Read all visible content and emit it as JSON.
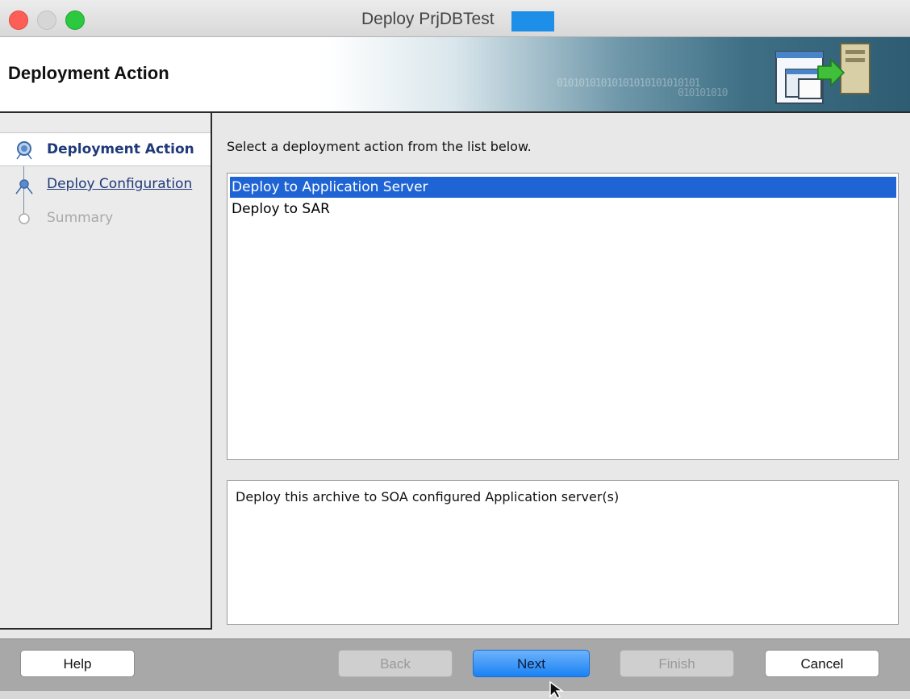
{
  "window": {
    "title": "Deploy PrjDBTest"
  },
  "header": {
    "title": "Deployment Action",
    "binary_text_1": "01010101010101010101010101",
    "binary_text_2": "010101010"
  },
  "nav": {
    "items": [
      {
        "label": "Deployment Action",
        "state": "current"
      },
      {
        "label": "Deploy Configuration",
        "state": "link"
      },
      {
        "label": "Summary",
        "state": "disabled"
      }
    ]
  },
  "main": {
    "prompt": "Select a deployment action from the list below.",
    "actions": [
      {
        "label": "Deploy to Application Server",
        "selected": true
      },
      {
        "label": "Deploy to SAR",
        "selected": false
      }
    ],
    "description": "Deploy this archive to SOA configured Application server(s)"
  },
  "footer": {
    "help": "Help",
    "back": "Back",
    "next": "Next",
    "finish": "Finish",
    "cancel": "Cancel"
  },
  "colors": {
    "selection": "#1f64d4",
    "primary_button": "#1a82f5",
    "nav_text": "#1f3a7a",
    "redaction": "#1e8fe8"
  }
}
